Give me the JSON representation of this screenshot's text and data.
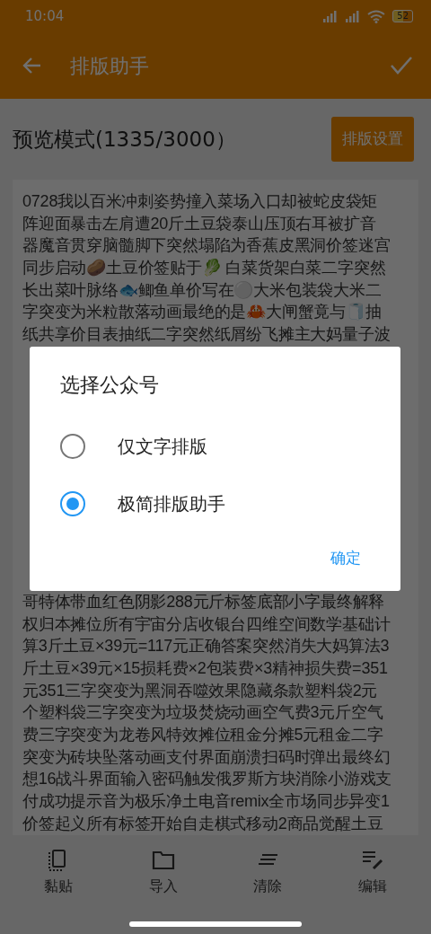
{
  "status_bar": {
    "time": "10:04",
    "battery": "52"
  },
  "app_bar": {
    "title": "排版助手"
  },
  "preview": {
    "heading": "预览模式(1335/3000）",
    "settings_button": "排版设置",
    "lines_above": [
      "0728我以百米冲刺姿势撞入菜场入口却被蛇皮袋矩",
      "阵迎面暴击左肩遭20斤土豆袋泰山压顶右耳被扩音",
      "器魔音贯穿脑髓脚下突然塌陷为香蕉皮黑洞价签迷宫",
      "同步启动🥔土豆价签贴于🥬 白菜货架白菜二字突然",
      "长出菜叶脉络🐟鲫鱼单价写在⚪大米包装袋大米二",
      "字突变为米粒散落动画最绝的是🦀大闸蟹竟与🧻抽",
      "纸共享价目表抽纸二字突然纸屑纷飞摊主大妈量子波"
    ],
    "lines_below": [
      "哥特体带血红色阴影288元斤标签底部小字最终解释",
      "权归本摊位所有宇宙分店收银台四维空间数学基础计",
      "算3斤土豆×39元=117元正确答案突然消失大妈算法3",
      "斤土豆×39元×15损耗费×2包装费×3精神损失费=351",
      "元351三字突变为黑洞吞噬效果隐藏条款塑料袋2元",
      "个塑料袋三字突变为垃圾焚烧动画空气费3元斤空气",
      "费三字突变为龙卷风特效摊位租金分摊5元租金二字",
      "突变为砖块坠落动画支付界面崩溃扫码时弹出最终幻",
      "想16战斗界面输入密码触发俄罗斯方块消除小游戏支",
      "付成功提示音为极乐净土电音remix全市场同步异变1",
      "价签起义所有标签开始自走棋式移动2商品觉醒土豆"
    ]
  },
  "dialog": {
    "title": "选择公众号",
    "options": [
      {
        "label": "仅文字排版",
        "selected": false
      },
      {
        "label": "极简排版助手",
        "selected": true
      }
    ],
    "confirm": "确定"
  },
  "bottom_nav": [
    {
      "kind": "paste",
      "label": "黏贴"
    },
    {
      "kind": "import",
      "label": "导入"
    },
    {
      "kind": "clear",
      "label": "清除"
    },
    {
      "kind": "edit",
      "label": "编辑"
    }
  ]
}
